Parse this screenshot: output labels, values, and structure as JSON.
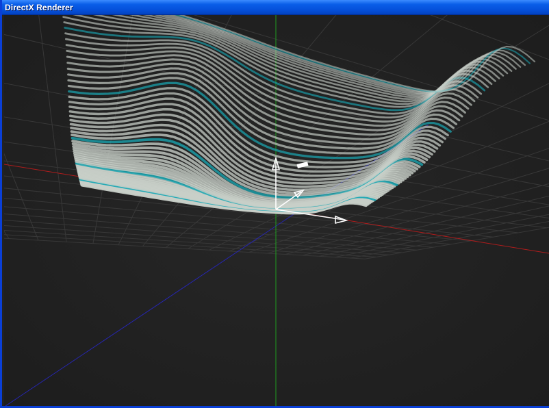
{
  "window": {
    "title": "DirectX Renderer"
  },
  "viewport": {
    "background_color": "#222222",
    "grid_color": "#363636",
    "axis_colors": {
      "x": "#c02020",
      "y": "#1fa81f",
      "z": "#2020c0"
    },
    "surface_stripe_colors": [
      "#c8cfc8",
      "#1a2422",
      "#1aa8b4"
    ],
    "gizmo_color": "#ffffff"
  }
}
